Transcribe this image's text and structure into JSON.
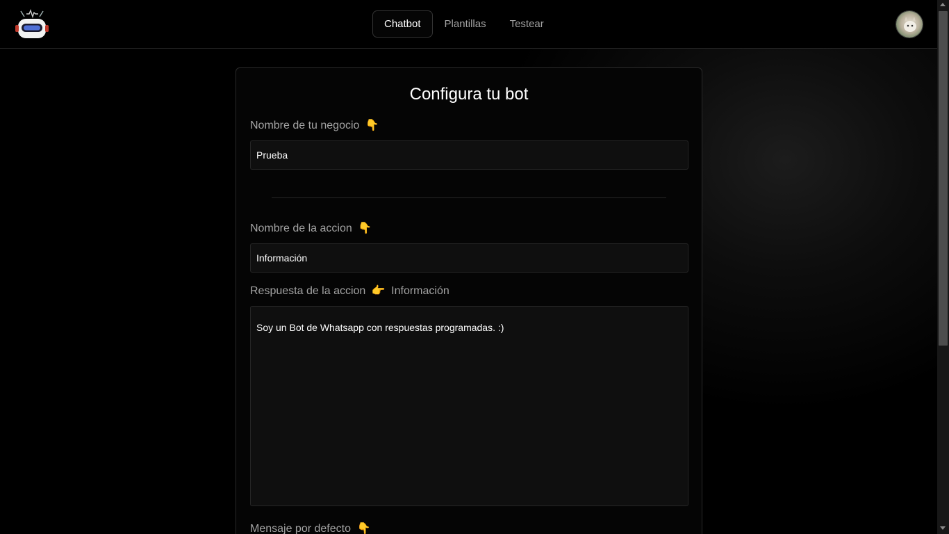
{
  "header": {
    "tabs": [
      {
        "label": "Chatbot",
        "active": true
      },
      {
        "label": "Plantillas",
        "active": false
      },
      {
        "label": "Testear",
        "active": false
      }
    ]
  },
  "form": {
    "title": "Configura tu bot",
    "business_name": {
      "label": "Nombre de tu negocio",
      "emoji": "👇",
      "value": "Prueba"
    },
    "action_name": {
      "label": "Nombre de la accion",
      "emoji": "👇",
      "value": "Información"
    },
    "action_response": {
      "label": "Respuesta de la accion",
      "emoji": "👉",
      "label_suffix": "Información",
      "value": "Soy un Bot de Whatsapp con respuestas programadas. :)"
    },
    "default_message": {
      "label": "Mensaje por defecto",
      "emoji": "👇"
    }
  },
  "colors": {
    "background": "#000000",
    "accent_emoji": "#d8a031",
    "muted_text": "#a3a3a3"
  },
  "icons": {
    "logo": "robot-logo-icon",
    "avatar": "user-avatar"
  }
}
